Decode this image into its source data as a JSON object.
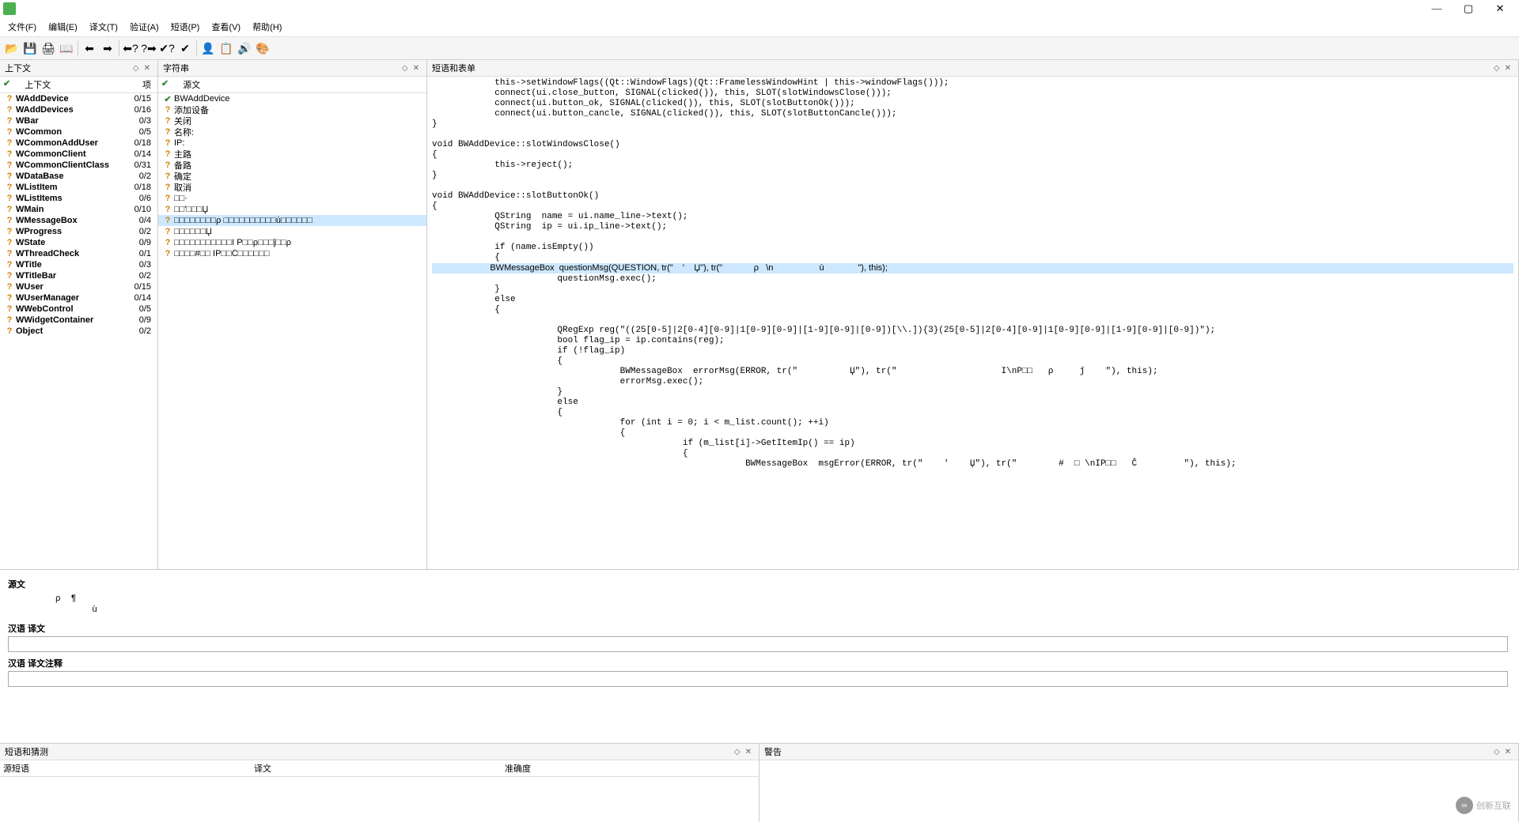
{
  "menu": {
    "file": "文件(F)",
    "edit": "编辑(E)",
    "translation": "译文(T)",
    "validation": "验证(A)",
    "phrases": "短语(P)",
    "view": "查看(V)",
    "help": "帮助(H)"
  },
  "toolIcons": [
    "📂",
    "💾",
    "🖨",
    "📖",
    "",
    "⬅",
    "➡",
    "",
    "⬅?",
    "?➡",
    "✔?",
    "✔",
    "",
    "👤",
    "📋",
    "🔊",
    "🎨"
  ],
  "panels": {
    "context": "上下文",
    "strings": "字符串",
    "forms": "短语和表单",
    "phrases": "短语和猜测",
    "warnings": "警告"
  },
  "contextCols": {
    "c1": "上下文",
    "c2": "项"
  },
  "stringCols": {
    "c1": "源文"
  },
  "context": [
    {
      "name": "WAddDevice",
      "items": "0/15",
      "bold": true
    },
    {
      "name": "WAddDevices",
      "items": "0/16",
      "bold": true
    },
    {
      "name": "WBar",
      "items": "0/3",
      "bold": true
    },
    {
      "name": "WCommon",
      "items": "0/5",
      "bold": true
    },
    {
      "name": "WCommonAddUser",
      "items": "0/18",
      "bold": true
    },
    {
      "name": "WCommonClient",
      "items": "0/14",
      "bold": true
    },
    {
      "name": "WCommonClientClass",
      "items": "0/31",
      "bold": true
    },
    {
      "name": "WDataBase",
      "items": "0/2",
      "bold": true
    },
    {
      "name": "WListItem",
      "items": "0/18",
      "bold": true
    },
    {
      "name": "WListItems",
      "items": "0/6",
      "bold": true
    },
    {
      "name": "WMain",
      "items": "0/10",
      "bold": true
    },
    {
      "name": "WMessageBox",
      "items": "0/4",
      "bold": true
    },
    {
      "name": "WProgress",
      "items": "0/2",
      "bold": true
    },
    {
      "name": "WState",
      "items": "0/9",
      "bold": true
    },
    {
      "name": "WThreadCheck",
      "items": "0/1",
      "bold": true
    },
    {
      "name": "WTitle",
      "items": "0/3",
      "bold": true
    },
    {
      "name": "WTitleBar",
      "items": "0/2",
      "bold": true
    },
    {
      "name": "WUser",
      "items": "0/15",
      "bold": true
    },
    {
      "name": "WUserManager",
      "items": "0/14",
      "bold": true
    },
    {
      "name": "WWebControl",
      "items": "0/5",
      "bold": true
    },
    {
      "name": "WWidgetContainer",
      "items": "0/9",
      "bold": true
    },
    {
      "name": "Object",
      "items": "0/2",
      "bold": true
    }
  ],
  "strings": [
    {
      "mark": "ok",
      "text": "BWAddDevice"
    },
    {
      "mark": "q",
      "text": "添加设备"
    },
    {
      "mark": "q",
      "text": "关闭"
    },
    {
      "mark": "q",
      "text": "名称:"
    },
    {
      "mark": "q",
      "text": "IP:"
    },
    {
      "mark": "q",
      "text": "主路"
    },
    {
      "mark": "q",
      "text": "备路"
    },
    {
      "mark": "q",
      "text": "确定"
    },
    {
      "mark": "q",
      "text": "取消"
    },
    {
      "mark": "q",
      "text": "□□·"
    },
    {
      "mark": "q",
      "text": "□□'□□□Џ"
    },
    {
      "mark": "q",
      "text": "□□□□□□□□ρ □□□□□□□□□□ù□□□□□□",
      "selected": true
    },
    {
      "mark": "q",
      "text": "□□□□□□Џ"
    },
    {
      "mark": "q",
      "text": "□□□□□□□□□□□I Ρ□□ρ□□□ĵ□□ρ"
    },
    {
      "mark": "q",
      "text": "□□□□#□□ IP□□Ĉ□□□□□□"
    }
  ],
  "code": [
    "            this->setWindowFlags((Qt::WindowFlags)(Qt::FramelessWindowHint | this->windowFlags()));",
    "            connect(ui.close_button, SIGNAL(clicked()), this, SLOT(slotWindowsClose()));",
    "            connect(ui.button_ok, SIGNAL(clicked()), this, SLOT(slotButtonOk()));",
    "            connect(ui.button_cancle, SIGNAL(clicked()), this, SLOT(slotButtonCancle()));",
    "}",
    "",
    "void BWAddDevice::slotWindowsClose()",
    "{",
    "            this->reject();",
    "}",
    "",
    "void BWAddDevice::slotButtonOk()",
    "{",
    "            QString  name = ui.name_line->text();",
    "            QString  ip = ui.ip_line->text();",
    "",
    "            if (name.isEmpty())",
    "            {"
  ],
  "codeHighlight": "                        BWMessageBox  questionMsg(QUESTION, tr(\"    '    Џ\"), tr(\"             ρ   \\n                   ù              \"), this);",
  "code2": [
    "                        questionMsg.exec();",
    "            }",
    "            else",
    "            {",
    "",
    "                        QRegExp reg(\"((25[0-5]|2[0-4][0-9]|1[0-9][0-9]|[1-9][0-9]|[0-9])[\\\\.]){3}(25[0-5]|2[0-4][0-9]|1[0-9][0-9]|[1-9][0-9]|[0-9])\");",
    "                        bool flag_ip = ip.contains(reg);",
    "                        if (!flag_ip)",
    "                        {",
    "                                    BWMessageBox  errorMsg(ERROR, tr(\"          Џ\"), tr(\"                    I\\nP□□   ρ     ĵ    \"), this);",
    "                                    errorMsg.exec();",
    "                        }",
    "                        else",
    "                        {",
    "                                    for (int i = 0; i < m_list.count(); ++i)",
    "                                    {",
    "                                                if (m_list[i]->GetItemIp() == ip)",
    "                                                {",
    "                                                            BWMessageBox  msgError(ERROR, tr(\"    '    Џ\"), tr(\"        #  □ \\nIP□□   Ĉ         \"), this);"
  ],
  "mid": {
    "srcLabel": "源文",
    "srcText": "ρ  ¶\n       ù",
    "transLabel": "汉语 译文",
    "commentLabel": "汉语 译文注释"
  },
  "phraseCols": {
    "c1": "源短语",
    "c2": "译文",
    "c3": "准确度"
  },
  "watermark": "创新互联"
}
